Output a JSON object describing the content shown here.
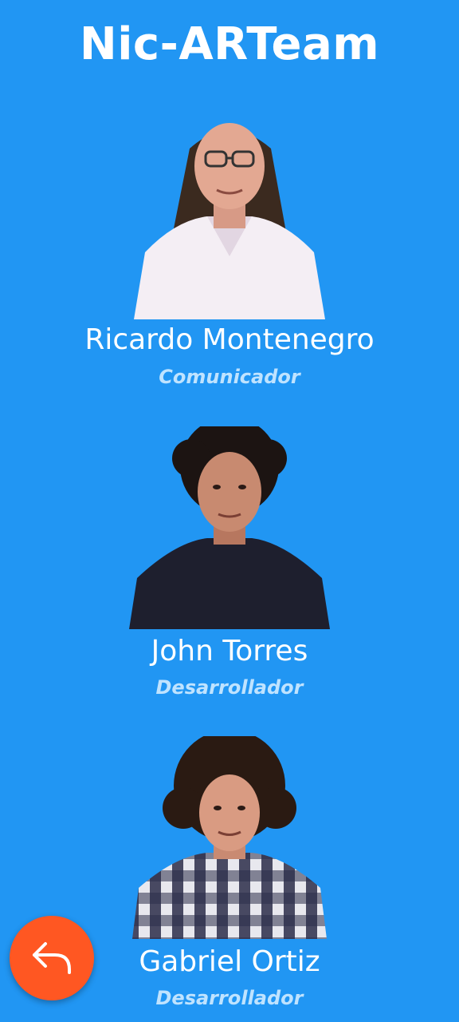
{
  "app": {
    "title": "Nic-ARTeam"
  },
  "team": [
    {
      "name": "Ricardo Montenegro",
      "role": "Comunicador",
      "photo_icon": "person-photo-glasses-white-shirt"
    },
    {
      "name": "John Torres",
      "role": "Desarrollador",
      "photo_icon": "person-photo-curly-dark-shirt"
    },
    {
      "name": "Gabriel Ortiz",
      "role": "Desarrollador",
      "photo_icon": "person-photo-curly-plaid-shirt"
    }
  ],
  "back_button": {
    "icon": "reply-arrow-icon"
  },
  "colors": {
    "background": "#2196F3",
    "accent": "#FF5722",
    "role_text": "#BFE3FF",
    "name_text": "#FFFFFF"
  }
}
